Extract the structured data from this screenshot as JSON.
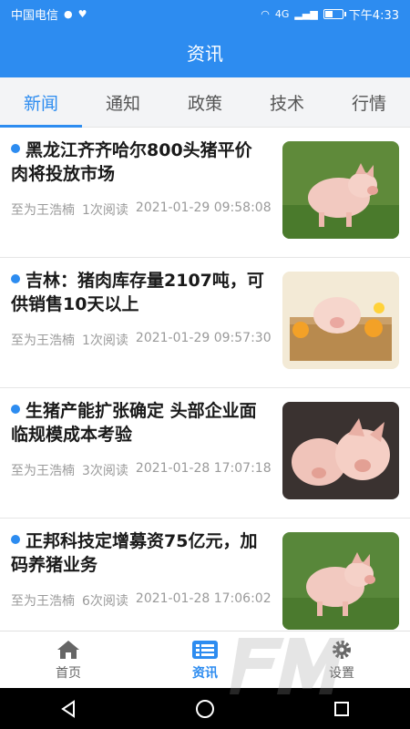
{
  "status_bar": {
    "carrier": "中国电信",
    "network": "4G",
    "time": "下午4:33",
    "battery_level": 0.5
  },
  "header": {
    "title": "资讯"
  },
  "tabs": [
    {
      "label": "新闻",
      "active": true
    },
    {
      "label": "通知",
      "active": false
    },
    {
      "label": "政策",
      "active": false
    },
    {
      "label": "技术",
      "active": false
    },
    {
      "label": "行情",
      "active": false
    }
  ],
  "news": [
    {
      "title": "黑龙江齐齐哈尔800头猪平价肉将投放市场",
      "author": "至为王浩楠",
      "reads": "1次阅读",
      "time": "2021-01-29 09:58:08"
    },
    {
      "title": "吉林：猪肉库存量2107吨，可供销售10天以上",
      "author": "至为王浩楠",
      "reads": "1次阅读",
      "time": "2021-01-29 09:57:30"
    },
    {
      "title": "生猪产能扩张确定 头部企业面临规模成本考验",
      "author": "至为王浩楠",
      "reads": "3次阅读",
      "time": "2021-01-28 17:07:18"
    },
    {
      "title": "正邦科技定增募资75亿元，加码养猪业务",
      "author": "至为王浩楠",
      "reads": "6次阅读",
      "time": "2021-01-28 17:06:02"
    }
  ],
  "bottom_nav": [
    {
      "label": "首页",
      "icon": "home-icon",
      "active": false
    },
    {
      "label": "资讯",
      "icon": "news-icon",
      "active": true
    },
    {
      "label": "设置",
      "icon": "gear-icon",
      "active": false
    }
  ],
  "colors": {
    "accent": "#2d8cf0",
    "text": "#1a1a1a",
    "meta": "#9a9a9a"
  }
}
